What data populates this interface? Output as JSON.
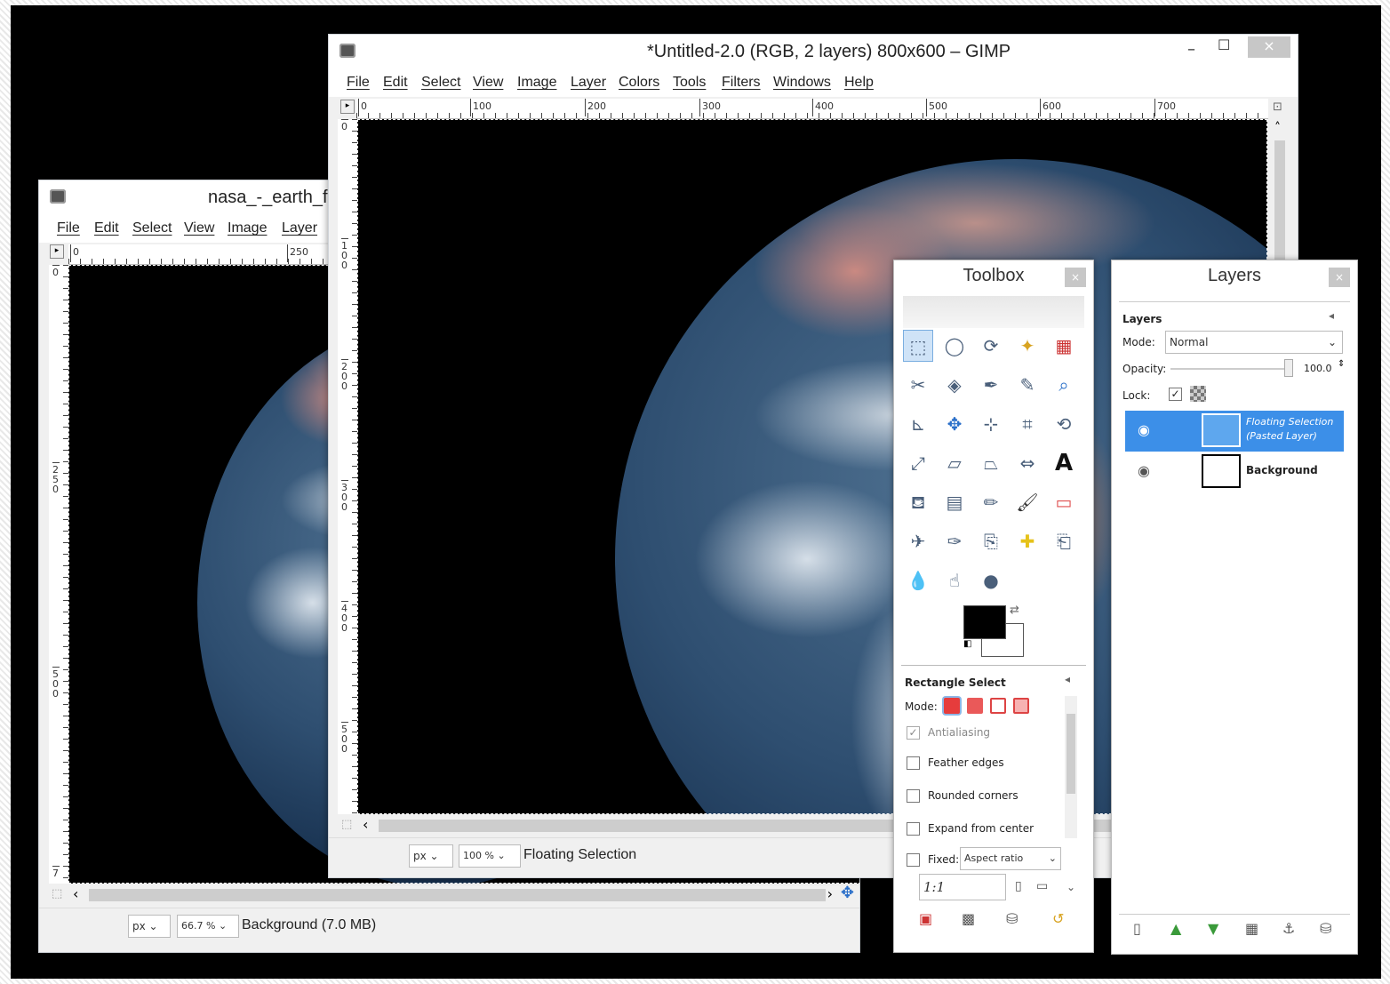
{
  "window_back": {
    "title": "nasa_-_earth_fro",
    "menu": [
      "File",
      "Edit",
      "Select",
      "View",
      "Image",
      "Layer"
    ],
    "ruler_top": [
      "0",
      "250"
    ],
    "ruler_left": [
      "0",
      "250",
      "500",
      "7"
    ],
    "unit": "px",
    "zoom": "66.7 %",
    "status": "Background (7.0 MB)"
  },
  "window_front": {
    "title": "*Untitled-2.0 (RGB, 2 layers) 800x600 – GIMP",
    "menu": [
      "File",
      "Edit",
      "Select",
      "View",
      "Image",
      "Layer",
      "Colors",
      "Tools",
      "Filters",
      "Windows",
      "Help"
    ],
    "ruler_top": [
      "0",
      "100",
      "200",
      "300",
      "400",
      "500",
      "600",
      "700"
    ],
    "ruler_left": [
      "0",
      "100",
      "200",
      "300",
      "400",
      "500"
    ],
    "unit": "px",
    "zoom": "100 %",
    "status": "Floating Selection",
    "minimize": "–",
    "maximize": "☐",
    "close": "×"
  },
  "toolbox": {
    "title": "Toolbox",
    "close": "×",
    "tools": [
      "rect-select",
      "ellipse-select",
      "free-select",
      "fuzzy-select",
      "color-select",
      "scissors",
      "foreground-select",
      "paths",
      "color-picker",
      "zoom",
      "measure",
      "move",
      "align",
      "crop",
      "rotate",
      "scale",
      "shear",
      "perspective",
      "flip",
      "text",
      "bucket-fill",
      "blend",
      "pencil",
      "paintbrush",
      "eraser",
      "airbrush",
      "ink",
      "clone",
      "heal",
      "perspective-clone",
      "blur",
      "smudge",
      "dodge-burn"
    ],
    "tool_options": {
      "heading": "Rectangle Select",
      "mode_label": "Mode:",
      "antialiasing": "Antialiasing",
      "feather": "Feather edges",
      "rounded": "Rounded corners",
      "expand": "Expand from center",
      "fixed_label": "Fixed:",
      "fixed_value": "Aspect ratio",
      "ratio": "1:1"
    }
  },
  "layers": {
    "title": "Layers",
    "close": "×",
    "section": "Layers",
    "mode_label": "Mode:",
    "mode_value": "Normal",
    "opacity_label": "Opacity:",
    "opacity_value": "100.0",
    "lock_label": "Lock:",
    "items": [
      {
        "name_line1": "Floating Selection",
        "name_line2": "(Pasted Layer)",
        "selected": true
      },
      {
        "name_line1": "Background",
        "name_line2": "",
        "selected": false
      }
    ]
  }
}
